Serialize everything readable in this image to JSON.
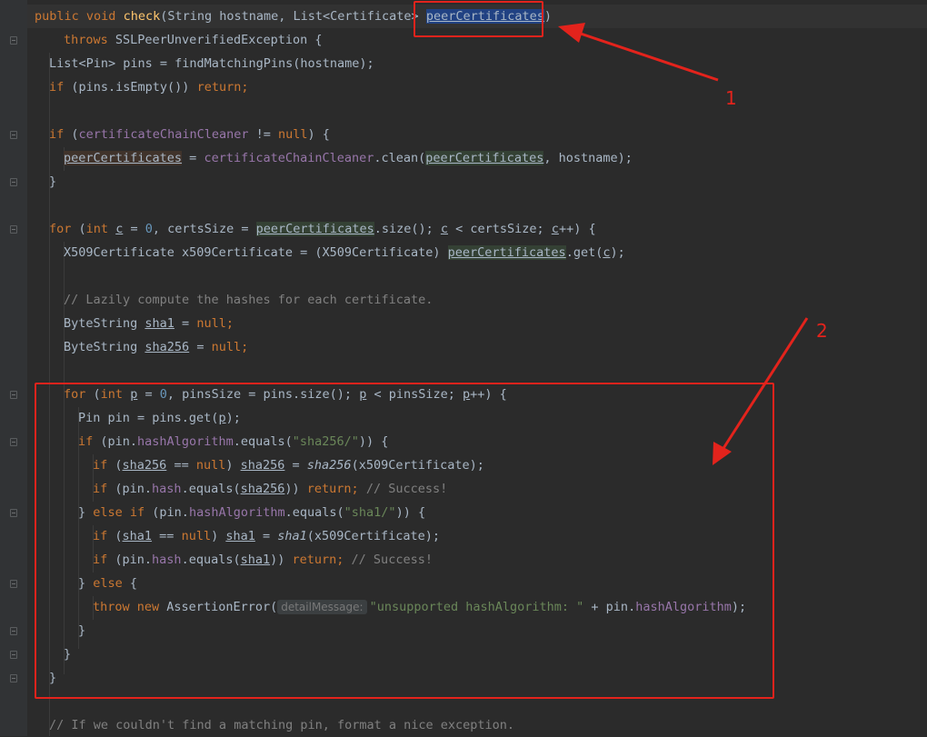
{
  "code": {
    "sig_public": "public",
    "sig_void": "void",
    "sig_method": "check",
    "sig_paren_open": "(String hostname, List<Certificate> ",
    "sig_param": "peerCertificates",
    "sig_paren_close": ")",
    "throws_kw": "throws",
    "throws_rest": " SSLPeerUnverifiedException {",
    "pins_decl": "List<Pin> pins = findMatchingPins(hostname);",
    "if_kw": "if",
    "isempty": " (pins.isEmpty()) ",
    "return_kw": "return",
    "semi": ";",
    "l5_field": "certificateChainCleaner",
    "l5_mid": " != ",
    "null_kw": "null",
    "l5_end": ") {",
    "peer_certs": "peerCertificates",
    "l6_mid": " = ",
    "l6_clean": ".clean(",
    "l6_end": ", hostname);",
    "close_brace": "}",
    "for_kw": "for",
    "int_kw": "int",
    "var_c": "c",
    "l8_a": " (",
    "l8_b": " = ",
    "zero": "0",
    "l8_c": ", certsSize = ",
    "l8_d": ".size(); ",
    "l8_e": " < certsSize; ",
    "l8_f": "++) {",
    "l9_a": "X509Certificate x509Certificate = (X509Certificate) ",
    "l9_b": ".get(",
    "l9_c": ");",
    "comment_lazy": "// Lazily compute the hashes for each certificate.",
    "bytestring": "ByteString ",
    "sha1": "sha1",
    "sha256": "sha256",
    "assign": " = ",
    "var_p": "p",
    "l13_c": ", pinsSize = pins.size(); ",
    "l13_e": " < pinsSize; ",
    "l13_f": "++) {",
    "pin_decl": "Pin pin = pins.get(",
    "pin_decl_end": ");",
    "pin_open": " (pin.",
    "hash_algo": "hashAlgorithm",
    "equals_open": ".equals(",
    "str_sha256": "\"sha256/\"",
    "str_sha1": "\"sha1/\"",
    "eq_close": ")) {",
    "if_open": " (",
    "eqeq": " == ",
    "null_close": ") ",
    "x509_arg": "(x509Certificate);",
    "hash_field": "hash",
    "dbl_close": ")) ",
    "success": " // Success!",
    "brace_else": "} ",
    "else_kw": "else",
    "else_if_kw": " if",
    "else_open": " {",
    "throw_kw": "throw",
    "new_kw": "new",
    "assertion": " AssertionError(",
    "hint_label": "detailMessage:",
    "str_unsupported": "\"unsupported hashAlgorithm: \"",
    "plus_pin": " + pin.",
    "assert_close": ");",
    "comment_final": "// If we couldn't find a matching pin, format a nice exception."
  },
  "annotations": {
    "label_1": "1",
    "label_2": "2"
  },
  "colors": {
    "background": "#2b2b2b",
    "gutter": "#313335",
    "keyword": "#cc7832",
    "method": "#ffc66d",
    "string": "#6a8759",
    "number": "#6897bb",
    "comment": "#808080",
    "field": "#9876aa",
    "text": "#a9b7c6",
    "annotation_red": "#e3231c"
  }
}
